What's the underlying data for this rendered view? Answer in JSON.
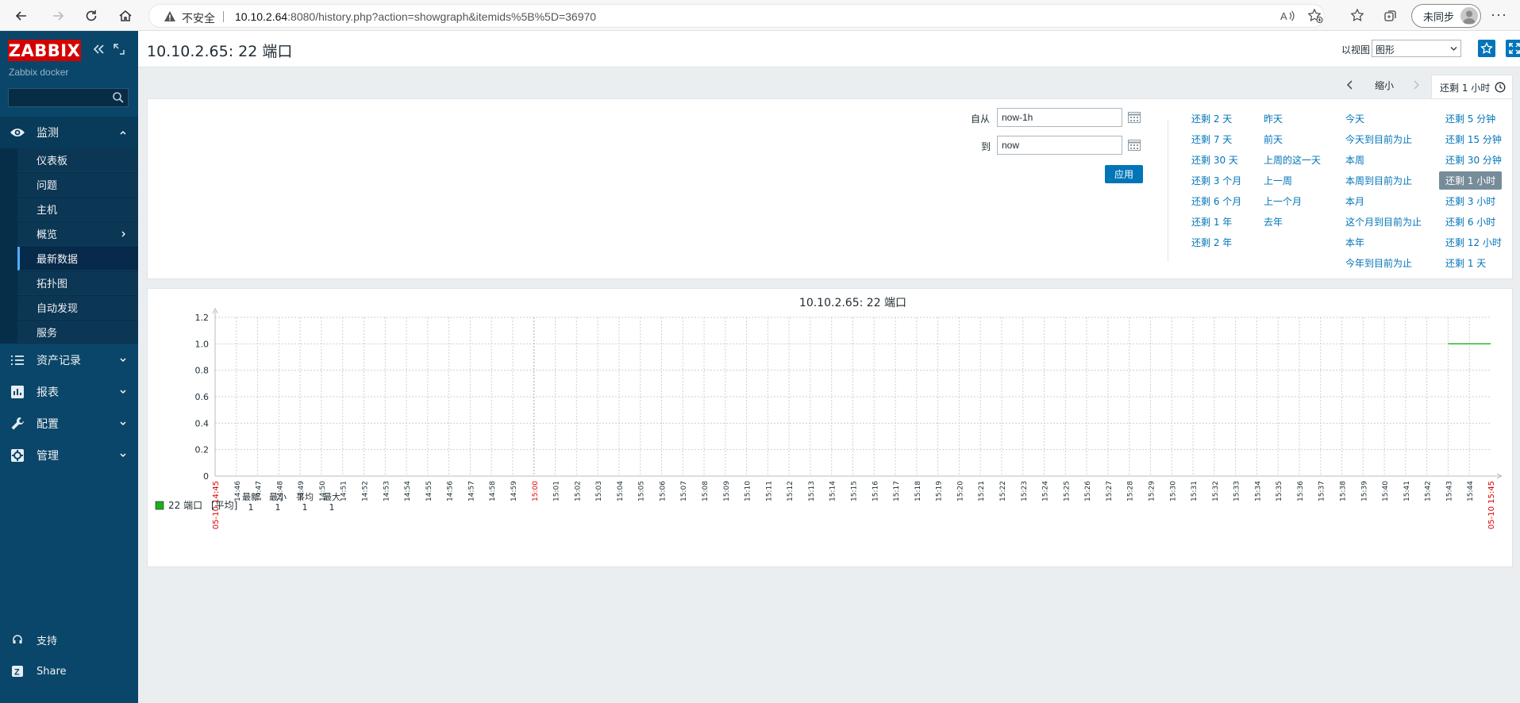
{
  "browser": {
    "insecure_label": "不安全",
    "url_host": "10.10.2.64",
    "url_rest": ":8080/history.php?action=showgraph&itemids%5B%5D=36970",
    "sync_label": "未同步"
  },
  "sidebar": {
    "logo": "ZABBIX",
    "server_name": "Zabbix docker",
    "search_value": "",
    "sections": [
      {
        "label": "监测",
        "icon": "eye-icon"
      },
      {
        "label": "资产记录",
        "icon": "list-icon"
      },
      {
        "label": "报表",
        "icon": "bar-chart-icon"
      },
      {
        "label": "配置",
        "icon": "wrench-icon"
      },
      {
        "label": "管理",
        "icon": "gear-icon"
      }
    ],
    "monitoring_items": [
      "仪表板",
      "问题",
      "主机",
      "概览",
      "最新数据",
      "拓扑图",
      "自动发现",
      "服务"
    ],
    "bottom": {
      "support": "支持",
      "share": "Share"
    }
  },
  "header": {
    "title": "10.10.2.65: 22 端口",
    "view_as_label": "以视图",
    "view_as_value": "图形"
  },
  "filter": {
    "zoom_out": "缩小",
    "range_tab": "还剩 1 小时",
    "from_label": "自从",
    "from_value": "now-1h",
    "to_label": "到",
    "to_value": "now",
    "apply": "应用",
    "quick_ranges": [
      [
        "还剩 2 天",
        "还剩 7 天",
        "还剩 30 天",
        "还剩 3 个月",
        "还剩 6 个月",
        "还剩 1 年",
        "还剩 2 年"
      ],
      [
        "昨天",
        "前天",
        "上周的这一天",
        "上一周",
        "上一个月",
        "去年"
      ],
      [
        "今天",
        "今天到目前为止",
        "本周",
        "本周到目前为止",
        "本月",
        "这个月到目前为止",
        "本年",
        "今年到目前为止"
      ],
      [
        "还剩 5 分钟",
        "还剩 15 分钟",
        "还剩 30 分钟",
        "还剩 1 小时",
        "还剩 3 小时",
        "还剩 6 小时",
        "还剩 12 小时",
        "还剩 1 天"
      ]
    ],
    "selected_range": "还剩 1 小时"
  },
  "graph": {
    "title": "10.10.2.65: 22 端口",
    "start_label": "05-10 14:45",
    "end_label": "05-10 15:45",
    "legend": {
      "item": "22 端口",
      "func": "[平均]",
      "col_headers": [
        "最新",
        "最小",
        "平均",
        "最大"
      ],
      "col_values": [
        "1",
        "1",
        "1",
        "1"
      ],
      "color": "#1ab01a"
    }
  },
  "chart_data": {
    "type": "line",
    "title": "10.10.2.65: 22 端口",
    "xlabel": "",
    "ylabel": "",
    "ylim": [
      0,
      1.2
    ],
    "yticks": [
      "0",
      "0.2",
      "0.4",
      "0.6",
      "0.8",
      "1.0",
      "1.2"
    ],
    "xticks": [
      "14:46",
      "14:47",
      "14:48",
      "14:49",
      "14:50",
      "14:51",
      "14:52",
      "14:53",
      "14:54",
      "14:55",
      "14:56",
      "14:57",
      "14:58",
      "14:59",
      "15:00",
      "15:01",
      "15:02",
      "15:03",
      "15:04",
      "15:05",
      "15:06",
      "15:07",
      "15:08",
      "15:09",
      "15:10",
      "15:11",
      "15:12",
      "15:13",
      "15:14",
      "15:15",
      "15:16",
      "15:17",
      "15:18",
      "15:19",
      "15:20",
      "15:21",
      "15:22",
      "15:23",
      "15:24",
      "15:25",
      "15:26",
      "15:27",
      "15:28",
      "15:29",
      "15:30",
      "15:31",
      "15:32",
      "15:33",
      "15:34",
      "15:35",
      "15:36",
      "15:37",
      "15:38",
      "15:39",
      "15:40",
      "15:41",
      "15:42",
      "15:43",
      "15:44"
    ],
    "xrange": [
      "14:45",
      "15:45"
    ],
    "grid": true,
    "series": [
      {
        "name": "22 端口",
        "color": "#1ab01a",
        "x": [
          "15:43",
          "15:45"
        ],
        "y": [
          1,
          1
        ]
      }
    ]
  }
}
